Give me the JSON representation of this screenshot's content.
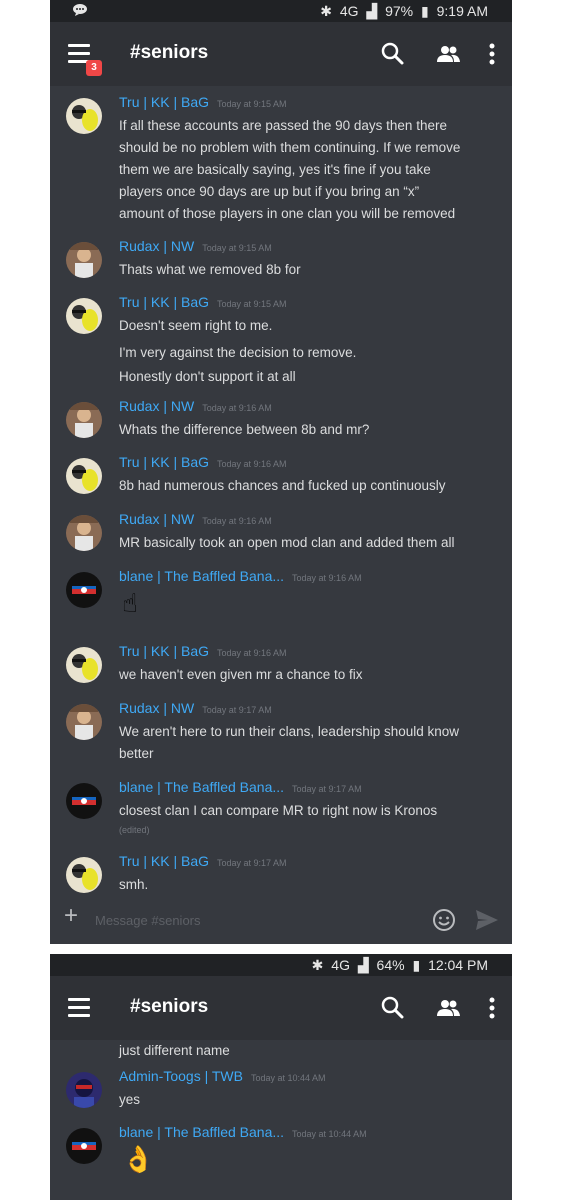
{
  "screen1": {
    "status": {
      "battery": "97%",
      "time": "9:19 AM",
      "network": "4G"
    },
    "header": {
      "channel": "#seniors",
      "badge": "3"
    },
    "messages": [
      {
        "author": "Tru | KK | BaG",
        "time": "Today at 9:15 AM",
        "avatar": "tru",
        "lines": [
          "If all these accounts are passed the 90 days then there",
          "should be no problem with them continuing. If we remove",
          "them we are basically saying, yes it's fine if you take",
          "players once 90 days are up but if you bring an “x”",
          "amount of those players in one clan you will be removed"
        ]
      },
      {
        "author": "Rudax | NW",
        "time": "Today at 9:15 AM",
        "avatar": "rudax",
        "lines": [
          "Thats what we removed 8b for"
        ]
      },
      {
        "author": "Tru | KK | BaG",
        "time": "Today at 9:15 AM",
        "avatar": "tru",
        "lines": [
          "Doesn't seem right to me.",
          "I'm very against the decision to remove.",
          "Honestly don't support it at all"
        ]
      },
      {
        "author": "Rudax | NW",
        "time": "Today at 9:16 AM",
        "avatar": "rudax",
        "lines": [
          "Whats the difference between 8b and mr?"
        ]
      },
      {
        "author": "Tru | KK | BaG",
        "time": "Today at 9:16 AM",
        "avatar": "tru",
        "lines": [
          "8b had numerous chances and fucked up continuously"
        ]
      },
      {
        "author": "Rudax | NW",
        "time": "Today at 9:16 AM",
        "avatar": "rudax",
        "lines": [
          "MR basically took an open mod clan and added them all"
        ]
      },
      {
        "author": "blane | The Baffled Bana...",
        "time": "Today at 9:16 AM",
        "avatar": "blane",
        "emoji": "☝"
      },
      {
        "author": "Tru | KK | BaG",
        "time": "Today at 9:16 AM",
        "avatar": "tru",
        "lines": [
          "we haven't even given mr a chance to fix"
        ]
      },
      {
        "author": "Rudax | NW",
        "time": "Today at 9:17 AM",
        "avatar": "rudax",
        "lines": [
          "We aren't here to run their clans, leadership should know",
          "better"
        ]
      },
      {
        "author": "blane | The Baffled Bana...",
        "time": "Today at 9:17 AM",
        "avatar": "blane",
        "lines": [
          "closest clan I can compare MR to right now is Kronos"
        ],
        "edited": "(edited)"
      },
      {
        "author": "Tru | KK | BaG",
        "time": "Today at 9:17 AM",
        "avatar": "tru",
        "lines": [
          "smh."
        ]
      }
    ],
    "composer": {
      "placeholder": "Message #seniors"
    }
  },
  "screen2": {
    "status": {
      "battery": "64%",
      "time": "12:04 PM",
      "network": "4G"
    },
    "header": {
      "channel": "#seniors"
    },
    "partial_line": "just different name",
    "messages": [
      {
        "author": "Admin-Toogs | TWB",
        "time": "Today at 10:44 AM",
        "avatar": "toogs",
        "lines": [
          "yes"
        ]
      },
      {
        "author": "blane | The Baffled Bana...",
        "time": "Today at 10:44 AM",
        "avatar": "blane",
        "emoji": "👌"
      }
    ]
  },
  "colors": {
    "background": "#36393f",
    "header": "#2f3136",
    "statusbar": "#202225",
    "author": "#3fa9f5",
    "text": "#dcddde",
    "timestamp": "#72767d",
    "badge": "#f04747"
  }
}
